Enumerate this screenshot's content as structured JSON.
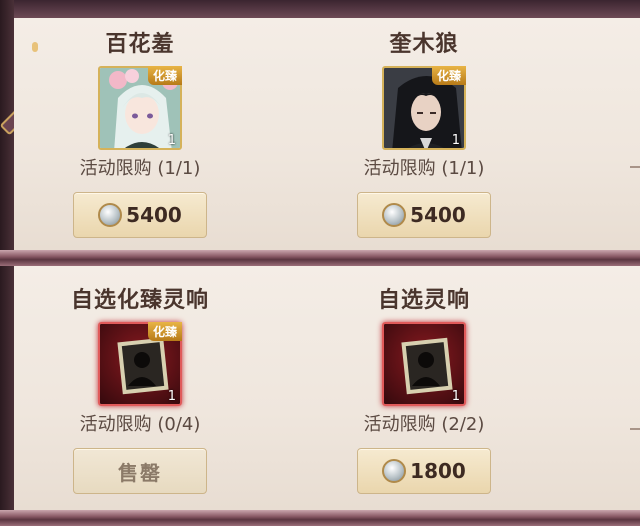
{
  "shop": {
    "items": [
      {
        "name": "百花羞",
        "badge": "化臻",
        "quantity": "1",
        "limit": "活动限购 (1/1)",
        "price": "5400",
        "sold_out": false
      },
      {
        "name": "奎木狼",
        "badge": "化臻",
        "quantity": "1",
        "limit": "活动限购 (1/1)",
        "price": "5400",
        "sold_out": false
      },
      {
        "name": "自选化臻灵响",
        "badge": "化臻",
        "quantity": "1",
        "limit": "活动限购 (0/4)",
        "button_label": "售罄",
        "sold_out": true
      },
      {
        "name": "自选灵响",
        "quantity": "1",
        "limit": "活动限购 (2/2)",
        "price": "1800",
        "sold_out": false
      }
    ]
  },
  "icons": {
    "currency": "mirror-icon",
    "mystery_item": "silhouette-icon"
  },
  "colors": {
    "gold_border": "#d5b25a",
    "red_border": "#e05a5a",
    "badge_gold": "#e8b445"
  }
}
